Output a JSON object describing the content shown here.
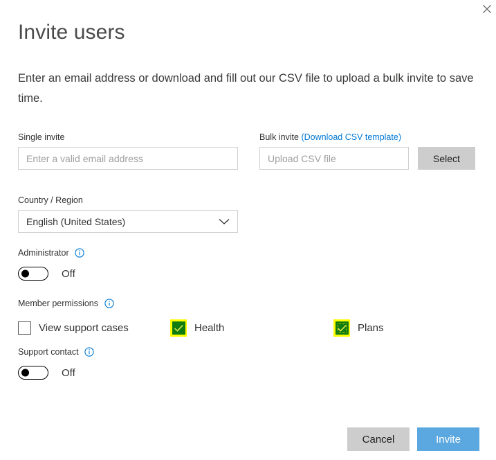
{
  "dialog": {
    "title": "Invite users",
    "description": "Enter an email address or download and fill out our CSV file to upload a bulk invite to save time.",
    "close_icon": "close-icon"
  },
  "single_invite": {
    "label": "Single invite",
    "placeholder": "Enter a valid email address",
    "value": ""
  },
  "bulk_invite": {
    "label": "Bulk invite",
    "link_label": "(Download CSV template)",
    "placeholder": "Upload CSV file",
    "value": "",
    "select_button": "Select"
  },
  "country_region": {
    "label": "Country / Region",
    "selected": "English (United States)",
    "chevron_icon": "chevron-down-icon"
  },
  "administrator": {
    "label": "Administrator",
    "info_icon": "info-icon",
    "state": "Off",
    "checked": false
  },
  "member_permissions": {
    "label": "Member permissions",
    "info_icon": "info-icon",
    "options": [
      {
        "label": "View support cases",
        "checked": false,
        "highlighted": false,
        "focused": false
      },
      {
        "label": "Health",
        "checked": true,
        "highlighted": true,
        "focused": false
      },
      {
        "label": "Plans",
        "checked": true,
        "highlighted": true,
        "focused": true
      }
    ]
  },
  "support_contact": {
    "label": "Support contact",
    "info_icon": "info-icon",
    "state": "Off",
    "checked": false
  },
  "footer": {
    "cancel_label": "Cancel",
    "invite_label": "Invite"
  },
  "colors": {
    "accent": "#0078d4",
    "primary_button": "#5ba7e0",
    "checkbox_checked": "#107c10",
    "highlight": "#ffff00",
    "neutral_button": "#cdcdcd"
  }
}
